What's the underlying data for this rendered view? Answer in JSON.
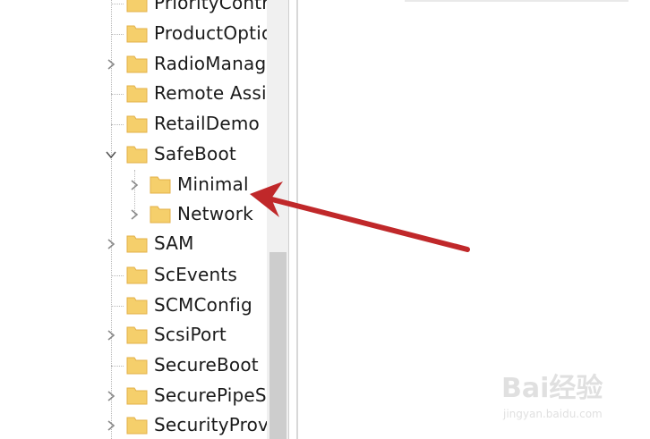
{
  "tree": {
    "items": [
      {
        "label": "PriorityControl",
        "expander": "none"
      },
      {
        "label": "ProductOptions",
        "expander": "none"
      },
      {
        "label": "RadioManagement",
        "expander": "collapsed"
      },
      {
        "label": "Remote Assistance",
        "expander": "none"
      },
      {
        "label": "RetailDemo",
        "expander": "none"
      },
      {
        "label": "SafeBoot",
        "expander": "expanded"
      },
      {
        "label": "Minimal",
        "expander": "collapsed"
      },
      {
        "label": "Network",
        "expander": "collapsed"
      },
      {
        "label": "SAM",
        "expander": "collapsed"
      },
      {
        "label": "ScEvents",
        "expander": "none"
      },
      {
        "label": "SCMConfig",
        "expander": "none"
      },
      {
        "label": "ScsiPort",
        "expander": "collapsed"
      },
      {
        "label": "SecureBoot",
        "expander": "none"
      },
      {
        "label": "SecurePipeServers",
        "expander": "collapsed"
      },
      {
        "label": "SecurityProviders",
        "expander": "collapsed"
      }
    ]
  },
  "annotation": {
    "arrow_color": "#c0282a"
  },
  "watermark": {
    "logo": "Bai经验",
    "url": "jingyan.baidu.com"
  },
  "colors": {
    "folder": "#f5cf6b",
    "folder_dark": "#e3b04a"
  }
}
